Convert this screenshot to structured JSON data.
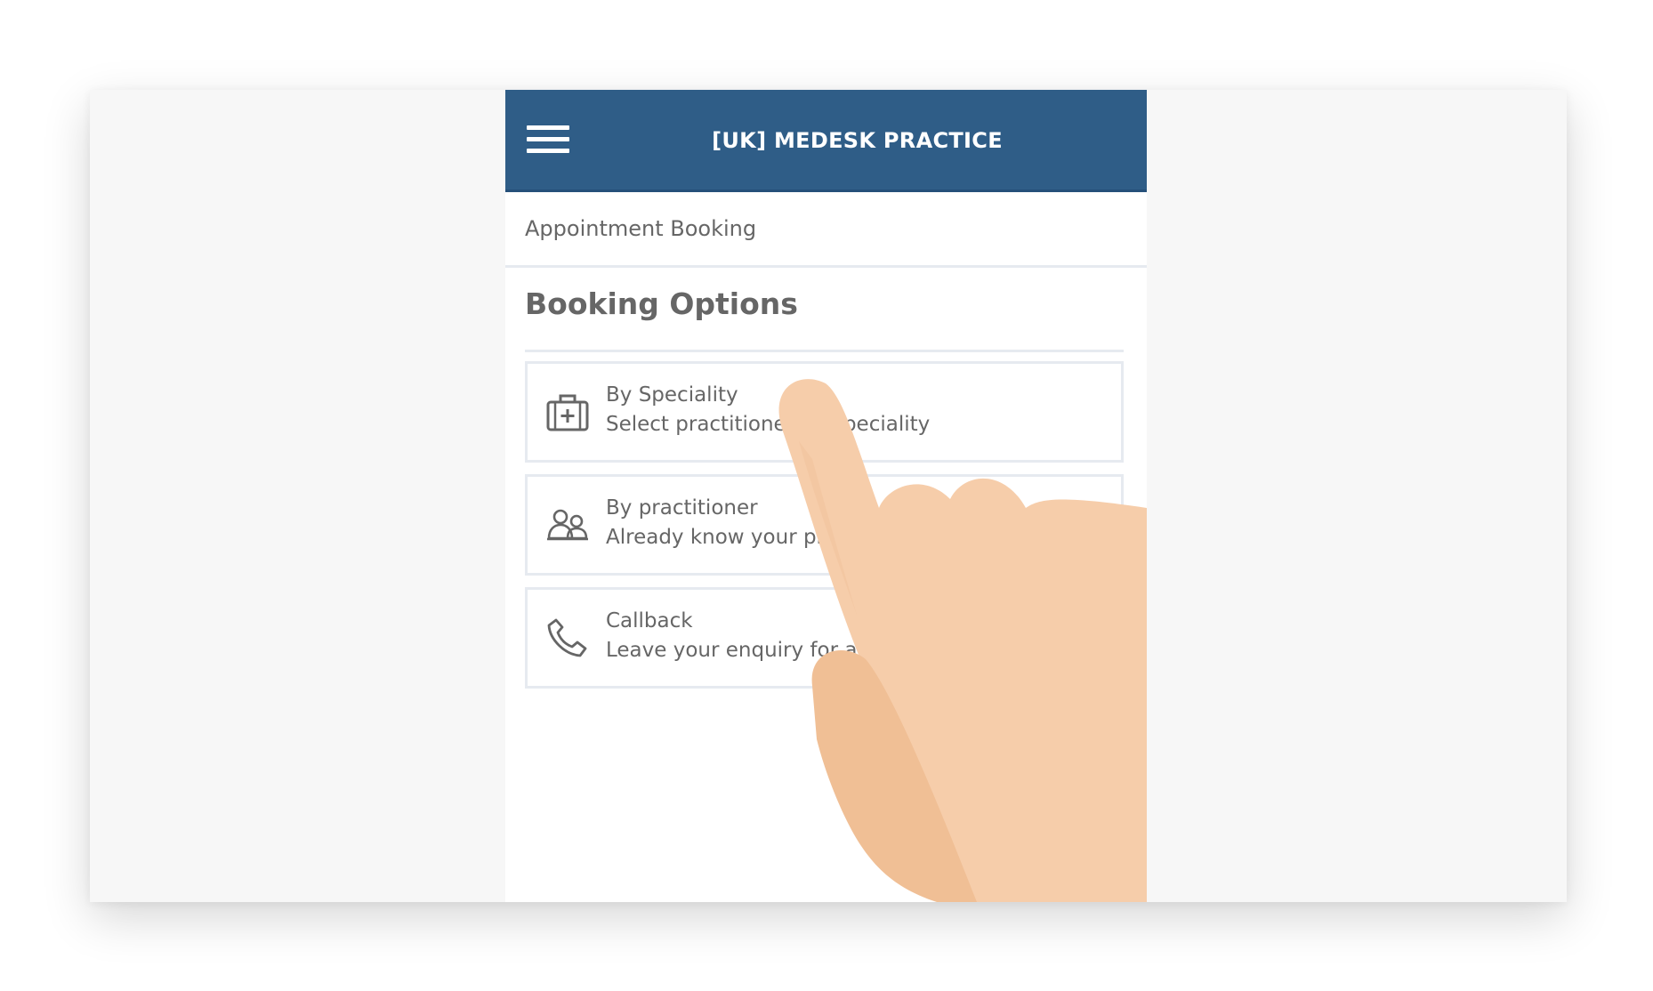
{
  "app": {
    "title": "[UK] MEDESK PRACTICE"
  },
  "breadcrumb": {
    "label": "Appointment Booking"
  },
  "section": {
    "title": "Booking Options"
  },
  "options": [
    {
      "icon": "medical-case-icon",
      "title": "By Speciality",
      "description": "Select practitioner by speciality"
    },
    {
      "icon": "practitioners-icon",
      "title": "By practitioner",
      "description": "Already know your practitioner? Book directly"
    },
    {
      "icon": "phone-icon",
      "title": "Callback",
      "description": "Leave your enquiry for a telephone callback"
    }
  ],
  "colors": {
    "appbar": "#2f5d87",
    "text": "#666666",
    "divider": "#e6eaf0",
    "hand": "#f6cdaa",
    "hand_shadow": "#f0bf95",
    "stage": "#f7f7f7"
  }
}
